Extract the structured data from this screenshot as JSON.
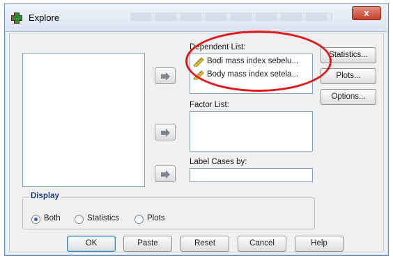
{
  "window": {
    "title": "Explore",
    "close_glyph": "x"
  },
  "source_list": {
    "items": []
  },
  "dependent": {
    "label": "Dependent List:",
    "items": [
      {
        "label": "Bodi mass index sebelu...",
        "icon": "scale-ruler-icon"
      },
      {
        "label": "Body mass index setela...",
        "icon": "scale-ruler-icon"
      }
    ]
  },
  "factor": {
    "label": "Factor List:"
  },
  "label_cases": {
    "label": "Label Cases by:"
  },
  "side_buttons": {
    "statistics": "Statistics...",
    "plots": "Plots...",
    "options": "Options..."
  },
  "display": {
    "title": "Display",
    "options": [
      {
        "label": "Both",
        "selected": true
      },
      {
        "label": "Statistics",
        "selected": false
      },
      {
        "label": "Plots",
        "selected": false
      }
    ]
  },
  "bottom_buttons": {
    "ok": "OK",
    "paste": "Paste",
    "reset": "Reset",
    "cancel": "Cancel",
    "help": "Help"
  },
  "colors": {
    "highlight": "#e3161a",
    "group_title": "#1e3f8a"
  }
}
